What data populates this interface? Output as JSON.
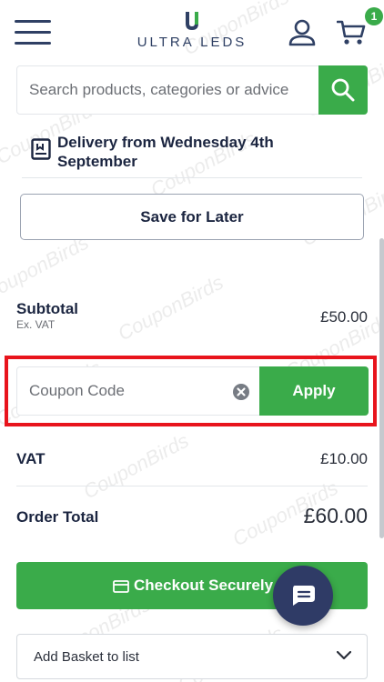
{
  "header": {
    "logo_text": "ULTRA LEDS",
    "cart_count": "1"
  },
  "search": {
    "placeholder": "Search products, categories or advice"
  },
  "delivery": {
    "text": "Delivery from Wednesday 4th September"
  },
  "save_for_later_label": "Save for Later",
  "summary": {
    "subtotal_label": "Subtotal",
    "subtotal_note": "Ex. VAT",
    "subtotal_value": "£50.00",
    "vat_label": "VAT",
    "vat_value": "£10.00",
    "total_label": "Order Total",
    "total_value": "£60.00"
  },
  "coupon": {
    "placeholder": "Coupon Code",
    "apply_label": "Apply"
  },
  "checkout_label": "Checkout Securely",
  "basket_list_label": "Add Basket to list",
  "watermark_text": "CouponBirds",
  "colors": {
    "brand_green": "#3aab4a",
    "navy": "#2f4064",
    "highlight_red": "#e8141c"
  },
  "icons": [
    "menu-icon",
    "logo-mark-icon",
    "user-icon",
    "cart-icon",
    "search-icon",
    "calendar-icon",
    "clear-icon",
    "credit-card-icon",
    "chat-icon",
    "chevron-down-icon"
  ]
}
